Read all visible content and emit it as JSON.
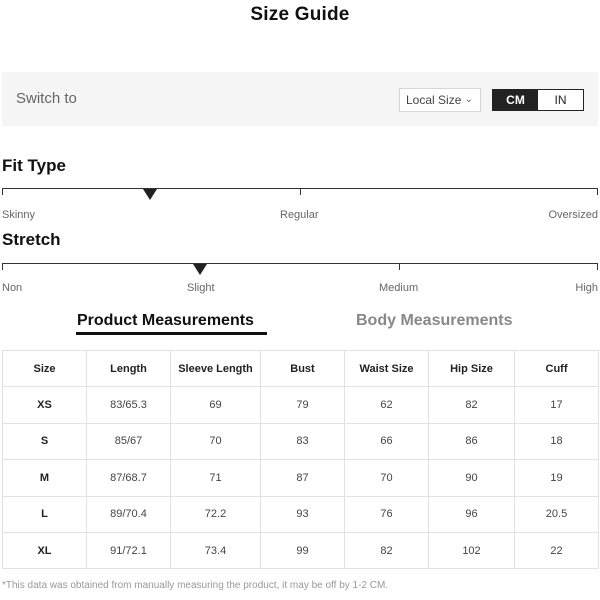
{
  "page": {
    "title": "Size Guide"
  },
  "switch_bar": {
    "label": "Switch to",
    "size_select": {
      "value": "Local Size"
    },
    "units": [
      {
        "label": "CM",
        "active": true
      },
      {
        "label": "IN",
        "active": false
      }
    ]
  },
  "fit_type": {
    "heading": "Fit Type",
    "labels": [
      "Skinny",
      "Regular",
      "Oversized"
    ],
    "selected_fraction": 0.25
  },
  "stretch": {
    "heading": "Stretch",
    "labels": [
      "Non",
      "Slight",
      "Medium",
      "High"
    ],
    "selected_fraction": 0.333
  },
  "tabs": {
    "product": "Product Measurements",
    "body": "Body Measurements",
    "active": "product"
  },
  "table": {
    "headers": [
      "Size",
      "Length",
      "Sleeve Length",
      "Bust",
      "Waist Size",
      "Hip Size",
      "Cuff"
    ],
    "rows": [
      [
        "XS",
        "83/65.3",
        "69",
        "79",
        "62",
        "82",
        "17"
      ],
      [
        "S",
        "85/67",
        "70",
        "83",
        "66",
        "86",
        "18"
      ],
      [
        "M",
        "87/68.7",
        "71",
        "87",
        "70",
        "90",
        "19"
      ],
      [
        "L",
        "89/70.4",
        "72.2",
        "93",
        "76",
        "96",
        "20.5"
      ],
      [
        "XL",
        "91/72.1",
        "73.4",
        "99",
        "82",
        "102",
        "22"
      ]
    ]
  },
  "footnote": "*This data was obtained from manually measuring the product, it may be off by 1-2 CM.",
  "icons": {
    "select_chevron": "chevron-down-icon",
    "scale_marker": "triangle-down-icon"
  }
}
